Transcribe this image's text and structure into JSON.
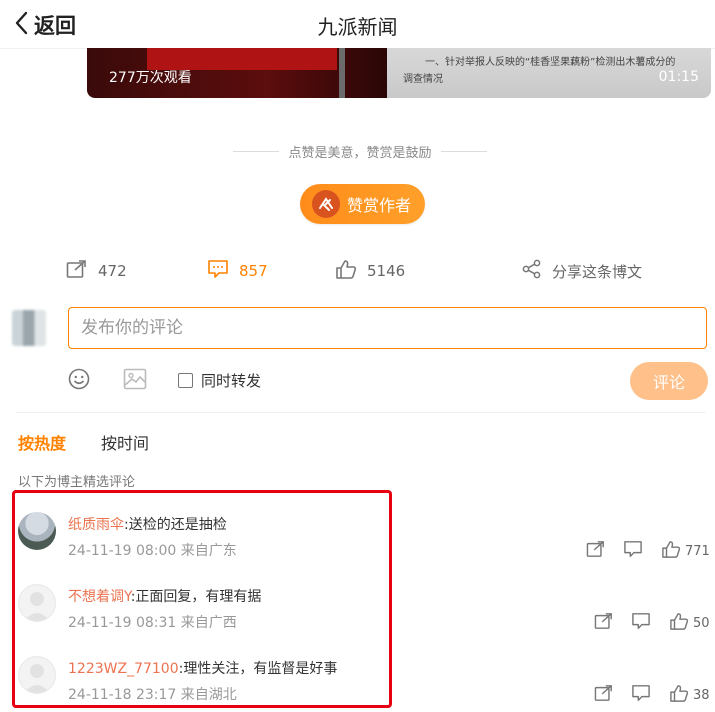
{
  "header": {
    "back_label": "返回",
    "title": "九派新闻"
  },
  "video": {
    "views": "277万次观看",
    "duration": "01:15",
    "doc_line1": "一、针对举报人反映的“桂香坚果藕粉”检测出木薯成分的",
    "doc_line2": "调查情况"
  },
  "tip": "点赞是美意，赞赏是鼓励",
  "reward_label": "赞赏作者",
  "actions": {
    "repost_count": "472",
    "comment_count": "857",
    "like_count": "5146",
    "share_label": "分享这条博文"
  },
  "composer": {
    "placeholder": "发布你的评论",
    "repost_label": "同时转发",
    "submit_label": "评论"
  },
  "sort": {
    "hot_label": "按热度",
    "time_label": "按时间"
  },
  "selected_note": "以下为博主精选评论",
  "comments": [
    {
      "name": "纸质雨伞",
      "text": ":送检的还是抽检",
      "time": "24-11-19 08:00",
      "source": "来自广东",
      "likes": "771"
    },
    {
      "name": "不想着调Y",
      "text": ":正面回复，有理有据",
      "time": "24-11-19 08:31",
      "source": "来自广西",
      "likes": "50"
    },
    {
      "name": "1223WZ_77100",
      "text": ":理性关注，有监督是好事",
      "time": "24-11-18 23:17",
      "source": "来自湖北",
      "likes": "38"
    }
  ],
  "colors": {
    "accent": "#ff8200",
    "username": "#eb7350",
    "highlight_box": "#e60012"
  },
  "icons": [
    "back-chevron-icon",
    "repost-icon",
    "comment-icon",
    "like-icon",
    "share-icon",
    "emoji-icon",
    "image-icon"
  ]
}
